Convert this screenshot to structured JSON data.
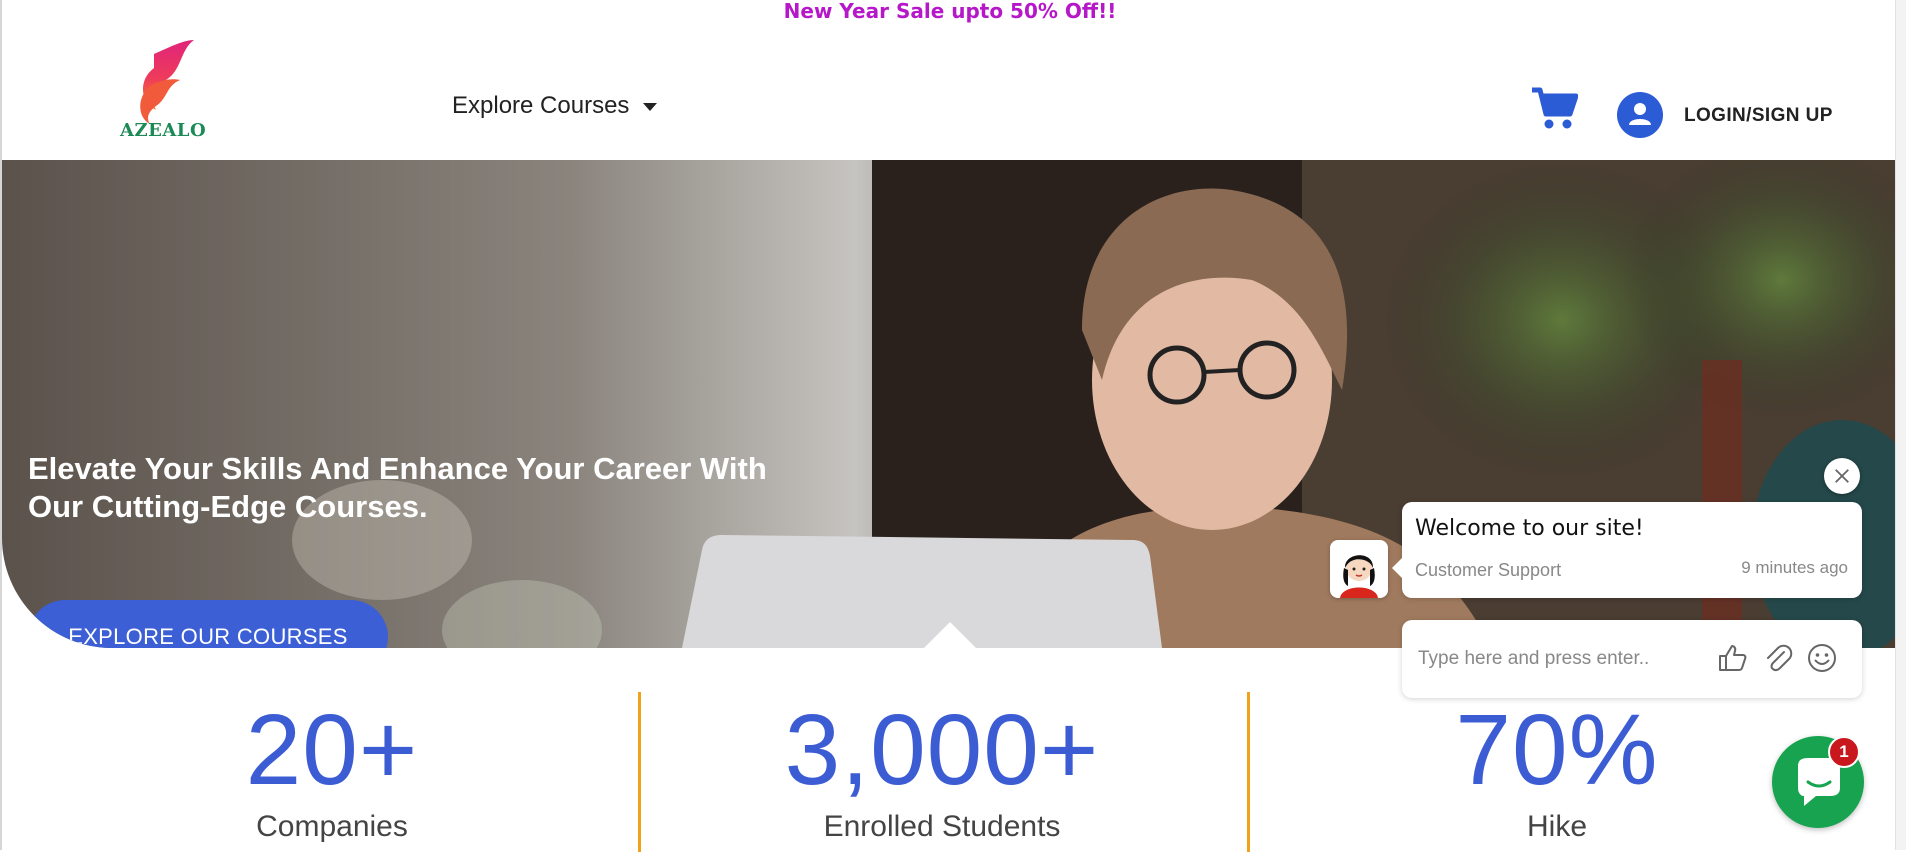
{
  "promo": {
    "text": "New Year Sale upto 50% Off!!"
  },
  "header": {
    "logo_text": "AZEALO",
    "nav_explore": "Explore Courses",
    "login_label": "LOGIN/SIGN UP"
  },
  "hero": {
    "title": "Elevate Your Skills And Enhance Your Career With Our Cutting-Edge Courses.",
    "cta_label": "EXPLORE OUR COURSES"
  },
  "stats": [
    {
      "value": "20+",
      "label": "Companies"
    },
    {
      "value": "3,000+",
      "label": "Enrolled Students"
    },
    {
      "value": "70%",
      "label": "Hike"
    }
  ],
  "chat": {
    "welcome": "Welcome to our site!",
    "agent": "Customer Support",
    "time": "9 minutes ago",
    "input_placeholder": "Type here and press enter..",
    "unread_count": "1"
  },
  "colors": {
    "promo": "#b517c9",
    "brand_blue": "#3c5fd6",
    "stat_blue": "#3c5cd4",
    "divider": "#f0a21b",
    "chat_green": "#17a34f"
  },
  "icons": [
    "logo-flame-icon",
    "caret-down-icon",
    "cart-icon",
    "user-icon",
    "close-icon",
    "thumbs-up-icon",
    "paperclip-icon",
    "emoji-icon",
    "chat-bubble-icon"
  ]
}
